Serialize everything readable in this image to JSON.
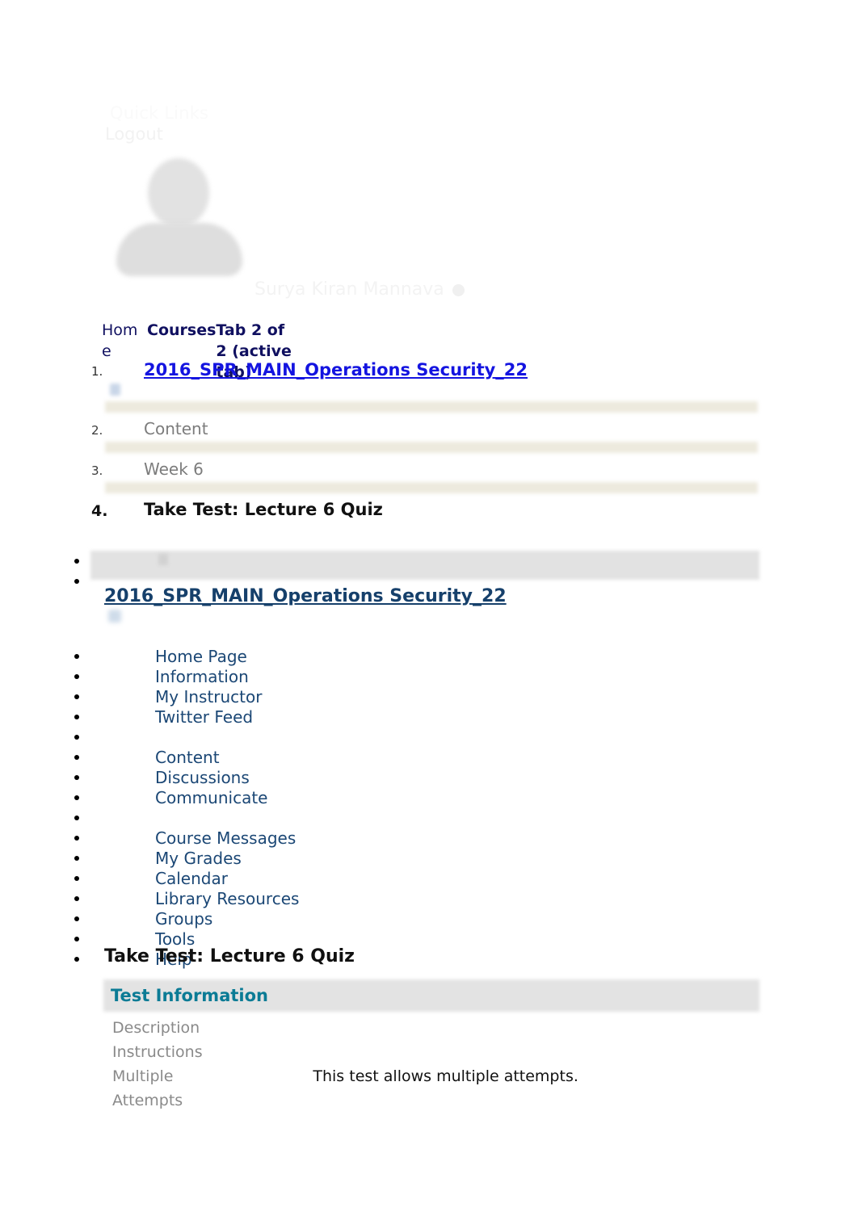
{
  "header": {
    "quick_links": "Quick Links",
    "logout": "Logout",
    "user_name": "Surya Kiran Mannava",
    "avatar_icon": "user-avatar-icon",
    "user_menu_icon": "chevron-circle-icon"
  },
  "tabs": {
    "home_label": "Home",
    "courses_label": "Courses",
    "active_state": "Tab 2 of 2 (active tab)"
  },
  "breadcrumb": {
    "items": [
      {
        "number": "1.",
        "label": "2016_SPR_MAIN_Operations Security_22",
        "is_link": true
      },
      {
        "number": "2.",
        "label": "Content",
        "is_link": false
      },
      {
        "number": "3.",
        "label": "Week 6",
        "is_link": false
      },
      {
        "number": "4.",
        "label": "Take Test: Lecture 6 Quiz",
        "is_link": false
      }
    ]
  },
  "course_nav": {
    "course_title": "2016_SPR_MAIN_Operations Security_22",
    "items": [
      {
        "label": ""
      },
      {
        "label": ""
      },
      {
        "label": "Home Page"
      },
      {
        "label": "Information"
      },
      {
        "label": "My Instructor"
      },
      {
        "label": "Twitter Feed"
      },
      {
        "label": ""
      },
      {
        "label": "Content"
      },
      {
        "label": "Discussions"
      },
      {
        "label": "Communicate"
      },
      {
        "label": ""
      },
      {
        "label": "Course Messages"
      },
      {
        "label": "My Grades"
      },
      {
        "label": "Calendar"
      },
      {
        "label": "Library Resources"
      },
      {
        "label": "Groups"
      },
      {
        "label": "Tools"
      },
      {
        "label": "Help"
      }
    ]
  },
  "main": {
    "page_title": "Take Test: Lecture 6 Quiz",
    "test_information": {
      "panel_title": "Test Information",
      "rows": [
        {
          "key": "Description",
          "value": ""
        },
        {
          "key": "Instructions",
          "value": ""
        },
        {
          "key": "Multiple Attempts",
          "value": "This test allows multiple attempts."
        }
      ]
    }
  },
  "colors": {
    "link_blue": "#1414e0",
    "nav_navy": "#1b4775",
    "course_navy": "#16406b",
    "panel_teal": "#0b7b95",
    "band_beige": "#edeade",
    "band_grey": "#e3e3e3",
    "tab_navy": "#101060"
  }
}
